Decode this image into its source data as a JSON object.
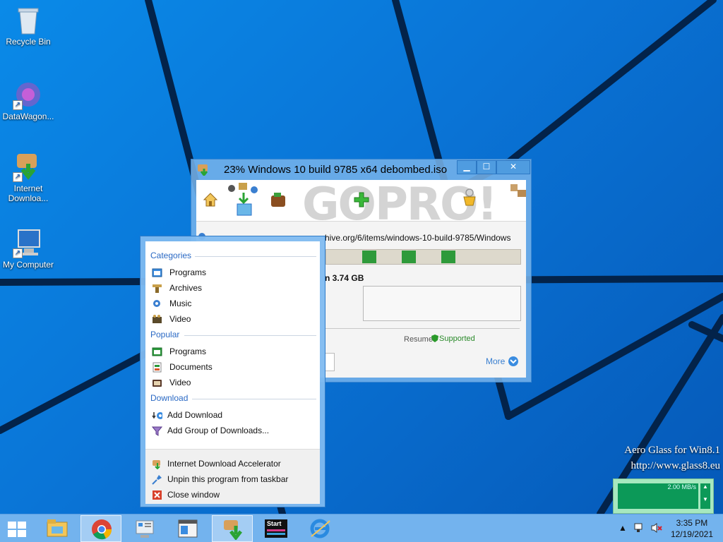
{
  "desktop": {
    "icons": [
      {
        "label": "Recycle Bin",
        "icon": "recycle-bin-icon"
      },
      {
        "label": "DataWagon...",
        "icon": "datawagon-icon"
      },
      {
        "label": "Internet Downloa...",
        "icon": "internet-download-accelerator-icon"
      },
      {
        "label": "My Computer",
        "icon": "computer-icon"
      }
    ]
  },
  "download_window": {
    "title": "23% Windows 10 build 9785 x64 debombed.iso",
    "watermark": "GOPRO!",
    "url_fragment": "hive.org/6/items/windows-10-build-9785/Windows",
    "size_text": "n 3.74 GB",
    "resume_label": "Resume:",
    "resume_value": "Supported",
    "more_label": "More",
    "progress_fraction": 0.23,
    "colors": {
      "progress": "#2e9a3a",
      "accent": "#3a7fd0"
    }
  },
  "jumplist": {
    "categories_header": "Categories",
    "categories": [
      {
        "label": "Programs",
        "icon": "programs-icon"
      },
      {
        "label": "Archives",
        "icon": "archives-icon"
      },
      {
        "label": "Music",
        "icon": "music-icon"
      },
      {
        "label": "Video",
        "icon": "video-icon"
      }
    ],
    "popular_header": "Popular",
    "popular": [
      {
        "label": "Programs",
        "icon": "programs-icon"
      },
      {
        "label": "Documents",
        "icon": "documents-icon"
      },
      {
        "label": "Video",
        "icon": "tv-icon"
      }
    ],
    "download_header": "Download",
    "download": [
      {
        "label": "Add Download",
        "icon": "add-download-icon"
      },
      {
        "label": "Add Group of Downloads...",
        "icon": "funnel-icon"
      }
    ],
    "footer": [
      {
        "label": "Internet Download Accelerator",
        "icon": "ida-icon"
      },
      {
        "label": "Unpin this program from taskbar",
        "icon": "unpin-icon"
      },
      {
        "label": "Close window",
        "icon": "close-window-icon"
      }
    ]
  },
  "aero": {
    "line1": "Aero Glass for Win8.1",
    "line2": "http://www.glass8.eu"
  },
  "net_widget": {
    "speed": "2.00 MB/s"
  },
  "taskbar": {
    "start_icon": "windows-logo-icon",
    "items": [
      "file-explorer-icon",
      "chrome-icon",
      "control-panel-icon",
      "window-icon",
      "ida-taskbar-icon",
      "start-app-icon",
      "internet-explorer-icon"
    ],
    "start_app_label": "Start",
    "time": "3:35 PM",
    "date": "12/19/2021"
  }
}
